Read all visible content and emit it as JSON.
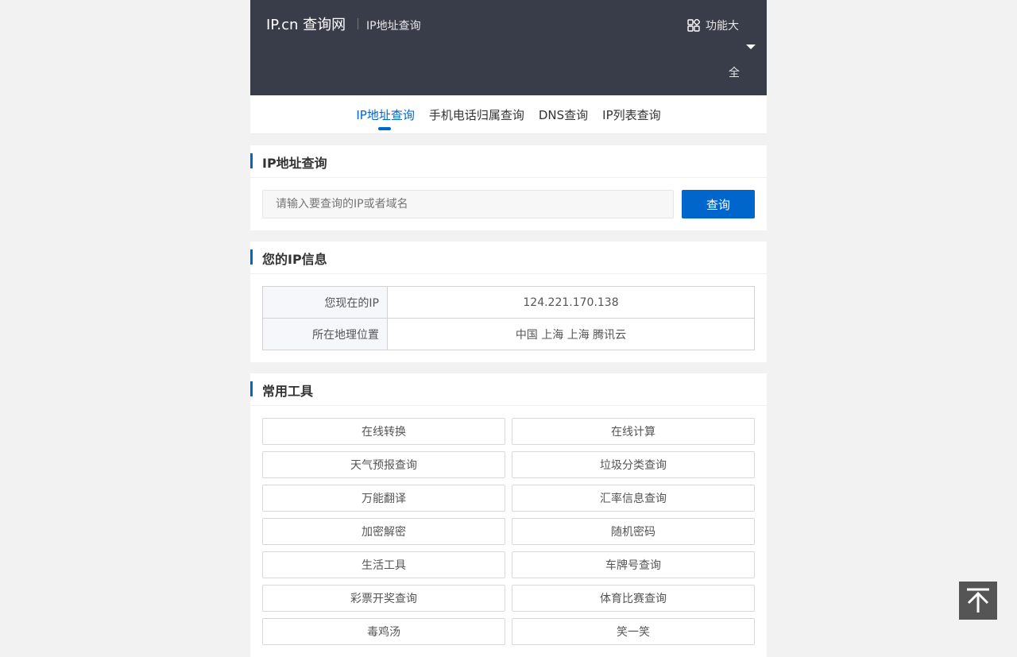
{
  "header": {
    "logo": "IP.cn 查询网",
    "subtitle": "IP地址查询",
    "menu_label": "功能大",
    "menu_label_tail": "全"
  },
  "tabs": [
    {
      "label": "IP地址查询",
      "active": true
    },
    {
      "label": "手机电话归属查询",
      "active": false
    },
    {
      "label": "DNS查询",
      "active": false
    },
    {
      "label": "IP列表查询",
      "active": false
    }
  ],
  "search_card": {
    "title": "IP地址查询",
    "placeholder": "请输入要查询的IP或者域名",
    "button_label": "查询"
  },
  "ip_card": {
    "title": "您的IP信息",
    "rows": [
      {
        "key": "您现在的IP",
        "value": "124.221.170.138"
      },
      {
        "key": "所在地理位置",
        "value": "中国 上海 上海 腾讯云"
      }
    ]
  },
  "tools_card": {
    "title": "常用工具",
    "items": [
      "在线转换",
      "在线计算",
      "天气预报查询",
      "垃圾分类查询",
      "万能翻译",
      "汇率信息查询",
      "加密解密",
      "随机密码",
      "生活工具",
      "车牌号查询",
      "彩票开奖查询",
      "体育比赛查询",
      "毒鸡汤",
      "笑一笑"
    ]
  },
  "colors": {
    "accent": "#0066cc",
    "header_bg": "#393d49"
  },
  "icons": {
    "menu": "grid-icon",
    "dropdown": "caret-down-icon",
    "back_to_top": "arrow-up-to-line-icon"
  }
}
